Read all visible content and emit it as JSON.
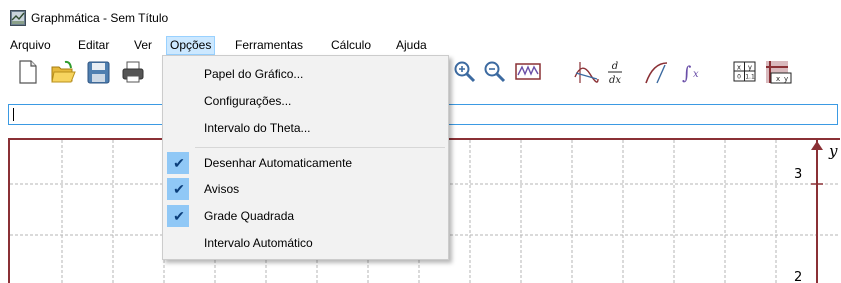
{
  "window": {
    "title": "Graphmática - Sem Título"
  },
  "menubar": {
    "items": [
      "Arquivo",
      "Editar",
      "Ver",
      "Opções",
      "Ferramentas",
      "Cálculo",
      "Ajuda"
    ],
    "active": "Opções"
  },
  "toolbar": {
    "icons": [
      "new-document-icon",
      "open-folder-icon",
      "save-disk-icon",
      "print-icon",
      "zoom-in-icon",
      "zoom-out-icon",
      "graph-wave-icon",
      "tangent-icon",
      "derivative-icon",
      "curve-icon",
      "integral-icon",
      "xy-table-icon",
      "data-plot-icon"
    ],
    "derivative_label": "d/dx",
    "integral_label": "∫x",
    "xy_table_header": "x y",
    "xy_table_values": "0 1.1",
    "xy_plot_label": "x y"
  },
  "expression": {
    "value": ""
  },
  "graph": {
    "y_axis_label": "y",
    "y_tick_labels": [
      "3",
      "2"
    ],
    "axis_color": "#8a3035",
    "grid_color": "#b6b6b6"
  },
  "options_menu": {
    "items": [
      {
        "label": "Papel do Gráfico...",
        "checked": false
      },
      {
        "label": "Configurações...",
        "checked": false
      },
      {
        "label": "Intervalo do Theta...",
        "checked": false
      },
      {
        "label": "Desenhar Automaticamente",
        "checked": true
      },
      {
        "label": "Avisos",
        "checked": true
      },
      {
        "label": "Grade Quadrada",
        "checked": true
      },
      {
        "label": "Intervalo Automático",
        "checked": false
      }
    ],
    "check_glyph": "✔"
  }
}
